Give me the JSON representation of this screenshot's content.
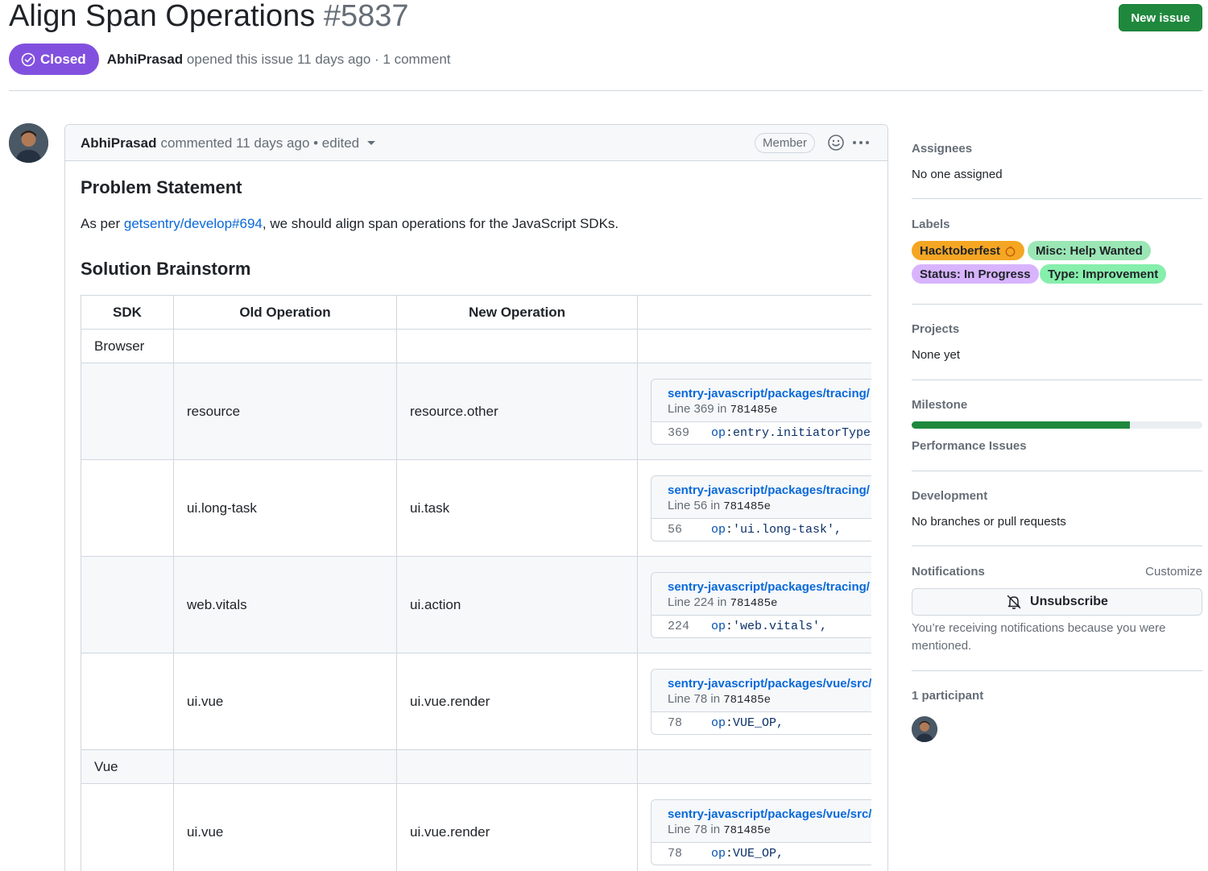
{
  "issue": {
    "title": "Align Span Operations",
    "number": "#5837",
    "new_issue_label": "New issue",
    "state": "Closed",
    "author": "AbhiPrasad",
    "meta": "opened this issue 11 days ago · 1 comment"
  },
  "comment": {
    "author": "AbhiPrasad",
    "meta": "commented 11 days ago • edited",
    "badge": "Member",
    "problem_heading": "Problem Statement",
    "para_prefix": "As per ",
    "para_link": "getsentry/develop#694",
    "para_suffix": ", we should align span operations for the JavaScript SDKs.",
    "solution_heading": "Solution Brainstorm"
  },
  "table": {
    "headers": [
      "SDK",
      "Old Operation",
      "New Operation",
      ""
    ],
    "rows": [
      {
        "sdk": "Browser",
        "old": "",
        "new": ""
      },
      {
        "sdk": "",
        "old": "resource",
        "new": "resource.other",
        "embed": {
          "path": "sentry-javascript/packages/tracing/",
          "line_label": "Line 369 in",
          "sha": "781485e",
          "line_no": "369",
          "code_key": "op",
          "code_rest": " entry.initiatorType"
        }
      },
      {
        "sdk": "",
        "old": "ui.long-task",
        "new": "ui.task",
        "embed": {
          "path": "sentry-javascript/packages/tracing/",
          "line_label": "Line 56 in",
          "sha": "781485e",
          "line_no": "56",
          "code_key": "op",
          "code_rest": " 'ui.long-task',"
        }
      },
      {
        "sdk": "",
        "old": "web.vitals",
        "new": "ui.action",
        "embed": {
          "path": "sentry-javascript/packages/tracing/",
          "line_label": "Line 224 in",
          "sha": "781485e",
          "line_no": "224",
          "code_key": "op",
          "code_rest": " 'web.vitals',"
        }
      },
      {
        "sdk": "",
        "old": "ui.vue",
        "new": "ui.vue.render",
        "embed": {
          "path": "sentry-javascript/packages/vue/src/",
          "line_label": "Line 78 in",
          "sha": "781485e",
          "line_no": "78",
          "code_key": "op",
          "code_rest": " VUE_OP,"
        }
      },
      {
        "sdk": "Vue",
        "old": "",
        "new": ""
      },
      {
        "sdk": "",
        "old": "ui.vue",
        "new": "ui.vue.render",
        "embed": {
          "path": "sentry-javascript/packages/vue/src/",
          "line_label": "Line 78 in",
          "sha": "781485e",
          "line_no": "78",
          "code_key": "op",
          "code_rest": " VUE_OP,"
        }
      }
    ]
  },
  "sidebar": {
    "assignees_title": "Assignees",
    "assignees_value": "No one assigned",
    "labels_title": "Labels",
    "labels": [
      {
        "text": "Hacktoberfest",
        "color": "#f5a623"
      },
      {
        "text": "Misc: Help Wanted",
        "color": "#9ae6b4"
      },
      {
        "text": "Status: In Progress",
        "color": "#d8b4fe"
      },
      {
        "text": "Type: Improvement",
        "color": "#86efac"
      }
    ],
    "projects_title": "Projects",
    "projects_value": "None yet",
    "milestone_title": "Milestone",
    "milestone_progress": 0.75,
    "milestone_name": "Performance Issues",
    "development_title": "Development",
    "development_value": "No branches or pull requests",
    "notifications_title": "Notifications",
    "customize": "Customize",
    "unsubscribe": "Unsubscribe",
    "notifications_text": "You’re receiving notifications because you were mentioned.",
    "participants_title": "1 participant"
  },
  "icons": [
    "closed-check-icon",
    "caret-down-icon",
    "smiley-icon",
    "kebab-icon",
    "bell-slash-icon",
    "pumpkin-icon"
  ]
}
